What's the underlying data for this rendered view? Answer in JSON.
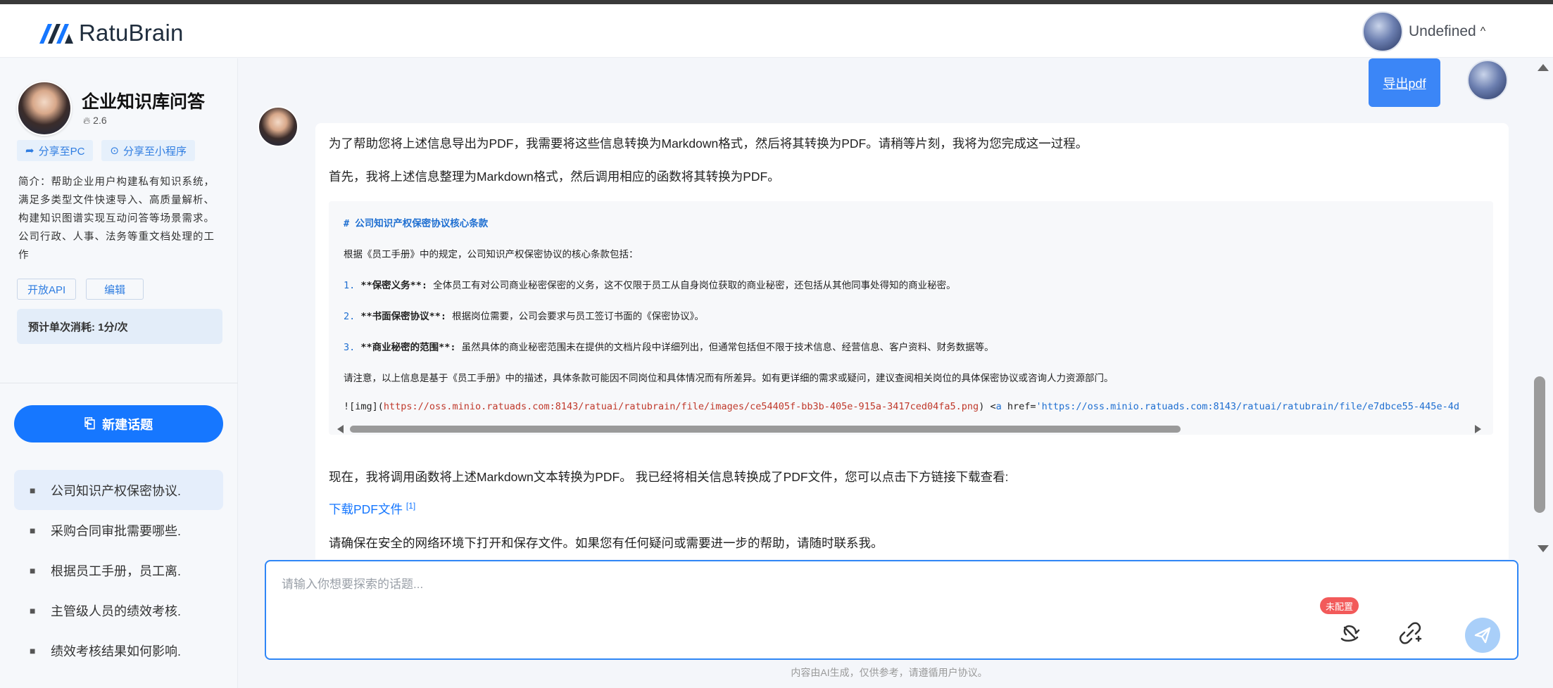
{
  "app": {
    "brand": "RatuBrain"
  },
  "user": {
    "name": "Undefined",
    "caret": "^"
  },
  "sidebar": {
    "bot_title": "企业知识库问答",
    "heat": "2.6",
    "share_pc": "分享至PC",
    "share_mini": "分享至小程序",
    "intro": "简介：帮助企业用户构建私有知识系统，满足多类型文件快速导入、高质量解析、构建知识图谱实现互动问答等场景需求。公司行政、人事、法务等重文档处理的工作",
    "open_api": "开放API",
    "edit": "编辑",
    "cost": "预计单次消耗: 1分/次",
    "new_topic": "新建话题",
    "history": [
      {
        "label": "公司知识产权保密协议."
      },
      {
        "label": "采购合同审批需要哪些."
      },
      {
        "label": "根据员工手册，员工离."
      },
      {
        "label": "主管级人员的绩效考核."
      },
      {
        "label": "绩效考核结果如何影响."
      }
    ]
  },
  "chat": {
    "export_label": "导出pdf",
    "p1": "为了帮助您将上述信息导出为PDF，我需要将这些信息转换为Markdown格式，然后将其转换为PDF。请稍等片刻，我将为您完成这一过程。",
    "p2": "首先，我将上述信息整理为Markdown格式，然后调用相应的函数将其转换为PDF。",
    "code": {
      "heading": "# 公司知识产权保密协议核心条款",
      "intro": "根据《员工手册》中的规定，公司知识产权保密协议的核心条款包括：",
      "item1_num": "1.",
      "item1_bold": "**保密义务**:",
      "item1_text": " 全体员工有对公司商业秘密保密的义务，这不仅限于员工从自身岗位获取的商业秘密，还包括从其他同事处得知的商业秘密。",
      "item2_num": "2.",
      "item2_bold": "**书面保密协议**:",
      "item2_text": " 根据岗位需要，公司会要求与员工签订书面的《保密协议》。",
      "item3_num": "3.",
      "item3_bold": "**商业秘密的范围**:",
      "item3_text": " 虽然具体的商业秘密范围未在提供的文档片段中详细列出，但通常包括但不限于技术信息、经营信息、客户资料、财务数据等。",
      "note": "请注意，以上信息是基于《员工手册》中的描述，具体条款可能因不同岗位和具体情况而有所差异。如有更详细的需求或疑问，建议查阅相关岗位的具体保密协议或咨询人力资源部门。",
      "img_prefix": "![img](",
      "img_url": "https://oss.minio.ratuads.com:8143/ratuai/ratubrain/file/images/ce54405f-bb3b-405e-915a-3417ced04fa5.png",
      "img_suffix": ") <",
      "a_tag": "a",
      "a_href_attr": " href=",
      "a_href": "'https://oss.minio.ratuads.com:8143/ratuai/ratubrain/file/e7dbce55-445e-4d"
    },
    "p3": "现在，我将调用函数将上述Markdown文本转换为PDF。 我已经将相关信息转换成了PDF文件，您可以点击下方链接下载查看:",
    "download_link": "下载PDF文件",
    "download_sup": "[1]",
    "p4": "请确保在安全的网络环境下打开和保存文件。如果您有任何疑问或需要进一步的帮助，请随时联系我。"
  },
  "composer": {
    "placeholder": "请输入你想要探索的话题...",
    "badge": "未配置"
  },
  "footer": {
    "note": "内容由AI生成，仅供参考，请遵循用户协议。"
  },
  "colors": {
    "primary": "#1677ff",
    "export": "#3b86f7",
    "badge": "#f25a5a"
  }
}
